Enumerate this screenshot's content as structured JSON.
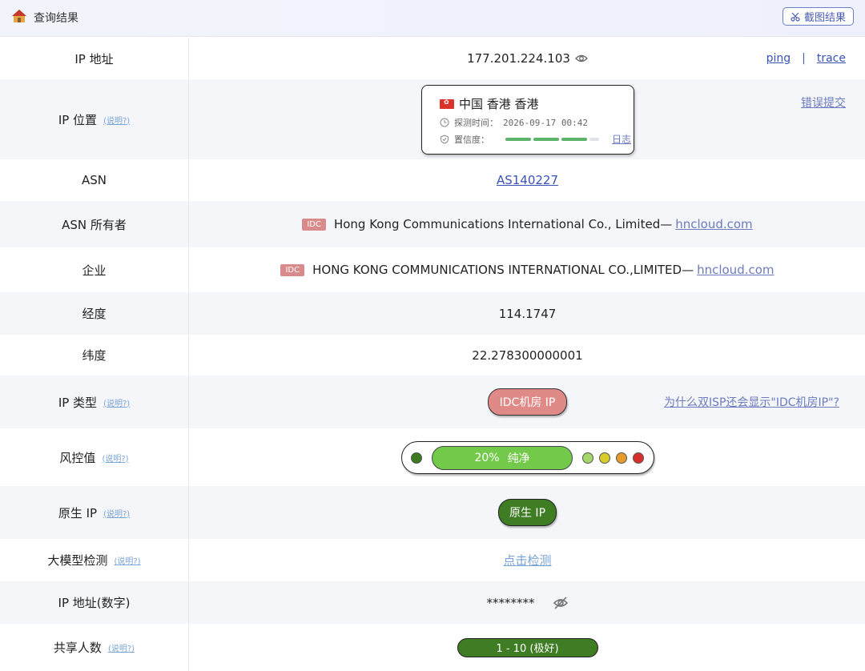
{
  "header": {
    "title": "查询结果",
    "screenshot_label": "截图结果"
  },
  "rows": {
    "ip": {
      "label": "IP 地址",
      "value": "177.201.224.103",
      "ping": "ping",
      "sep": "|",
      "trace": "trace"
    },
    "location": {
      "label": "IP 位置",
      "hint": "(说明?)",
      "place": "中国 香港 香港",
      "time_label": "探测时间：",
      "time_value": "2026-09-17 00:42",
      "conf_label": "置信度：",
      "log_link": "日志",
      "error_link": "错误提交"
    },
    "asn": {
      "label": "ASN",
      "value": "AS140227"
    },
    "asn_owner": {
      "label": "ASN 所有者",
      "tag": "IDC",
      "value": "Hong Kong Communications International Co., Limited—",
      "domain": "hncloud.com"
    },
    "company": {
      "label": "企业",
      "tag": "IDC",
      "value": "HONG KONG COMMUNICATIONS INTERNATIONAL CO.,LIMITED—",
      "domain": "hncloud.com"
    },
    "longitude": {
      "label": "经度",
      "value": "114.1747"
    },
    "latitude": {
      "label": "纬度",
      "value": "22.278300000001"
    },
    "ip_type": {
      "label": "IP 类型",
      "hint": "(说明?)",
      "value": "IDC机房 IP",
      "why_link": "为什么双ISP还会显示\"IDC机房IP\"?"
    },
    "risk": {
      "label": "风控值",
      "hint": "(说明?)",
      "percent": "20%",
      "text": "纯净",
      "level": 0.2
    },
    "native": {
      "label": "原生 IP",
      "hint": "(说明?)",
      "value": "原生 IP"
    },
    "llm": {
      "label": "大模型检测",
      "hint": "(说明?)",
      "value": "点击检测"
    },
    "ip_numeric": {
      "label": "IP 地址(数字)",
      "value": "********"
    },
    "shared": {
      "label": "共享人数",
      "hint": "(说明?)",
      "value": "1 - 10 (极好)"
    }
  },
  "colors": {
    "risk_dots": [
      "#3c7a22",
      "#a6d66b",
      "#d9cc2d",
      "#e69b2a",
      "#d6302a"
    ],
    "green_confidence": "#5cb36a",
    "idc_tag": "#d98b8b"
  }
}
